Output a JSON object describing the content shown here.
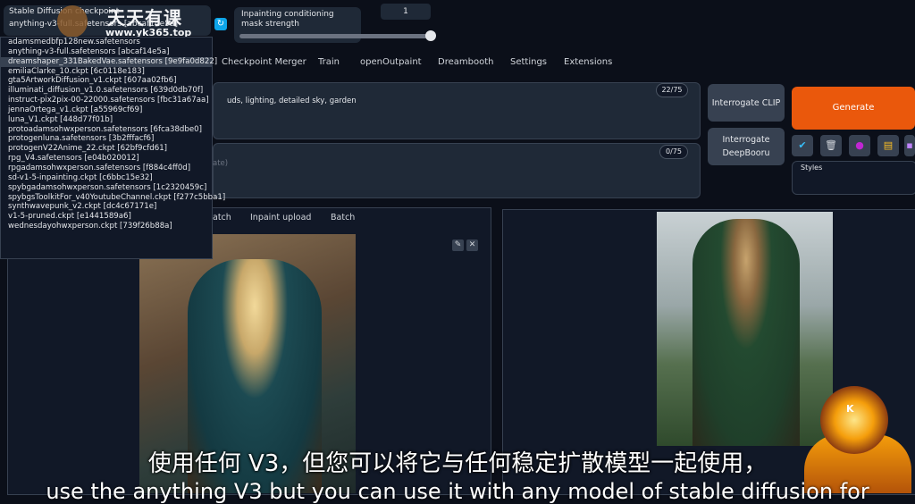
{
  "checkpoint": {
    "label": "Stable Diffusion checkpoint",
    "value": "anything-v3-full.safetensors [abcaf14e5a]",
    "options": [
      "adamsmedbfp128new.safetensors",
      "anything-v3-full.safetensors [abcaf14e5a]",
      "dreamshaper_331BakedVae.safetensors [9e9fa0d822]",
      "emiliaClarke_10.ckpt [6c0118e183]",
      "gta5ArtworkDiffusion_v1.ckpt [607aa02fb6]",
      "illuminati_diffusion_v1.0.safetensors [639d0db70f]",
      "instruct-pix2pix-00-22000.safetensors [fbc31a67aa]",
      "jennaOrtega_v1.ckpt [a55969cf69]",
      "luna_V1.ckpt [448d77f01b]",
      "protoadamsohwxperson.safetensors [6fca38dbe0]",
      "protogenluna.safetensors [3b2fffacf6]",
      "protogenV22Anime_22.ckpt [62bf9cfd61]",
      "rpg_V4.safetensors [e04b020012]",
      "rpgadamsohwxperson.safetensors [f884c4ff0d]",
      "sd-v1-5-inpainting.ckpt [c6bbc15e32]",
      "spybgadamsohwxperson.safetensors [1c2320459c]",
      "spybgsToolkitFor_v40YoutubeChannel.ckpt [f277c5bba1]",
      "synthwavepunk_v2.ckpt [dc4c67171e]",
      "v1-5-pruned.ckpt [e1441589a6]",
      "wednesdayohwxperson.ckpt [739f26b88a]"
    ],
    "selected_index": 2
  },
  "mask": {
    "label": "Inpainting conditioning mask strength",
    "value": "1",
    "fraction": 1.0
  },
  "tabs": [
    "Checkpoint Merger",
    "Train",
    "openOutpaint",
    "Dreambooth",
    "Settings",
    "Extensions"
  ],
  "prompt": {
    "text": "uds, lighting, detailed sky, garden",
    "tokens": "22/75"
  },
  "negative": {
    "text": "ate)",
    "tokens": "0/75"
  },
  "buttons": {
    "interrogate_clip": "Interrogate CLIP",
    "interrogate_deepbooru": "Interrogate DeepBooru",
    "generate": "Generate"
  },
  "styles_label": "Styles",
  "subtabs": [
    "atch",
    "Inpaint upload",
    "Batch"
  ],
  "icons": {
    "refresh": "refresh-icon",
    "edit": "pencil-icon",
    "close": "close-icon"
  },
  "watermark": {
    "title": "天天有课",
    "url": "www.yk365.top"
  },
  "subtitles": {
    "cn": "使用任何 V3，但您可以将它与任何稳定扩散模型一起使用，",
    "en": "use the anything V3 but you can use it with any model of stable diffusion for"
  },
  "avatar_letter": "K",
  "colors": {
    "accent": "#ea580c",
    "background": "#0b0f19",
    "panel": "#1f2937"
  }
}
